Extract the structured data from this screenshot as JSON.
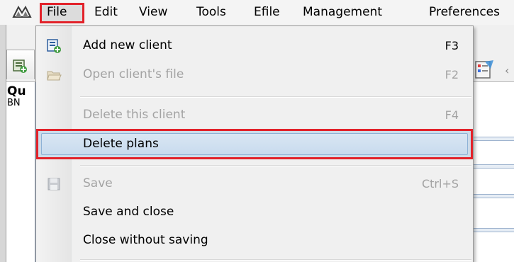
{
  "menubar": {
    "items": [
      {
        "label": "File"
      },
      {
        "label": "Edit"
      },
      {
        "label": "View"
      },
      {
        "label": "Tools"
      },
      {
        "label": "Efile"
      },
      {
        "label": "Management"
      },
      {
        "label": "Preferences"
      }
    ],
    "app_icon": "app-logo-icon"
  },
  "background": {
    "panel_title": "Qu",
    "panel_subtitle": "BN",
    "tab_icon": "client-tab-icon",
    "right_icon": "checklist-icon"
  },
  "file_menu": {
    "items": [
      {
        "label": "Add new client",
        "shortcut": "F3",
        "enabled": true,
        "icon": "add-client-icon"
      },
      {
        "label": "Open client's file",
        "shortcut": "F2",
        "enabled": false,
        "icon": "open-folder-icon"
      },
      {
        "label": "Delete this client",
        "shortcut": "F4",
        "enabled": false
      },
      {
        "label": "Delete plans",
        "shortcut": "",
        "enabled": true,
        "highlighted": true
      },
      {
        "label": "Save",
        "shortcut": "Ctrl+S",
        "enabled": false,
        "icon": "save-disk-icon"
      },
      {
        "label": "Save and close",
        "shortcut": "",
        "enabled": true
      },
      {
        "label": "Close without saving",
        "shortcut": "",
        "enabled": true
      }
    ]
  },
  "colors": {
    "highlight_border": "#e2222a",
    "hover_fill": "#ccdbe9",
    "disabled_text": "#a3a3a3"
  }
}
